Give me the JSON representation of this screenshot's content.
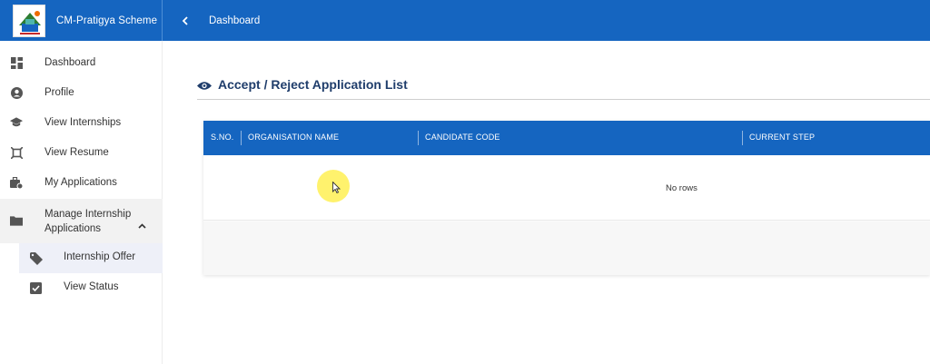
{
  "app": {
    "title": "CM-Pratigya Scheme"
  },
  "header": {
    "breadcrumb": "Dashboard"
  },
  "sidebar": {
    "items": [
      {
        "label": "Dashboard",
        "icon": "dashboard-icon"
      },
      {
        "label": "Profile",
        "icon": "profile-icon"
      },
      {
        "label": "View Internships",
        "icon": "graduation-cap-icon"
      },
      {
        "label": "View Resume",
        "icon": "resume-icon"
      },
      {
        "label": "My Applications",
        "icon": "briefcase-icon"
      },
      {
        "label": "Manage Internship Applications",
        "icon": "folder-icon",
        "expanded": true
      }
    ],
    "sub_items": [
      {
        "label": "Internship Offer",
        "icon": "tag-icon",
        "active": true
      },
      {
        "label": "View Status",
        "icon": "checkbox-icon"
      }
    ]
  },
  "main": {
    "section_title": "Accept / Reject Application List",
    "table": {
      "columns": [
        "S.NO.",
        "ORGANISATION NAME",
        "CANDIDATE CODE",
        "CURRENT STEP"
      ],
      "empty_text": "No rows"
    }
  },
  "colors": {
    "primary": "#1565c0",
    "title": "#1f3d6b",
    "active_bg": "#eef0f8"
  }
}
